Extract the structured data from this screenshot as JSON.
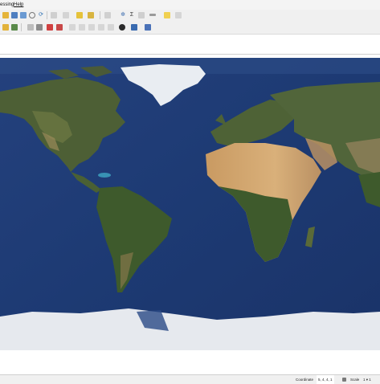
{
  "menu": {
    "processing_label": "essing",
    "help_label": "Help"
  },
  "statusbar": {
    "coordinate_label": "Coordinate",
    "coordinate_value": "5, 4, 4, 1",
    "scale_label": "Scale",
    "scale_value": "1 ▾ 1"
  },
  "icons": {
    "toolbar1": [
      "open-project-icon",
      "save-project-icon",
      "save-as-icon",
      "print-layout-icon",
      "refresh-icon",
      "pan-icon",
      "zoom-in-icon",
      "zoom-out-icon",
      "identify-icon",
      "select-icon",
      "settings-icon",
      "sum-icon",
      "table-icon",
      "annotation-icon"
    ],
    "toolbar2": [
      "add-vector-icon",
      "add-raster-icon",
      "digitize-icon",
      "edit-icon",
      "node-tool-icon",
      "cut-icon",
      "paste-icon",
      "undo-icon",
      "redo-icon",
      "globe-icon",
      "python-icon",
      "plugin-icon"
    ]
  },
  "colors": {
    "ocean": "#1f3a74",
    "ocean_deep": "#182f62",
    "land": "#4c5f34",
    "desert": "#c9a067",
    "ice": "#e8ecf1"
  }
}
